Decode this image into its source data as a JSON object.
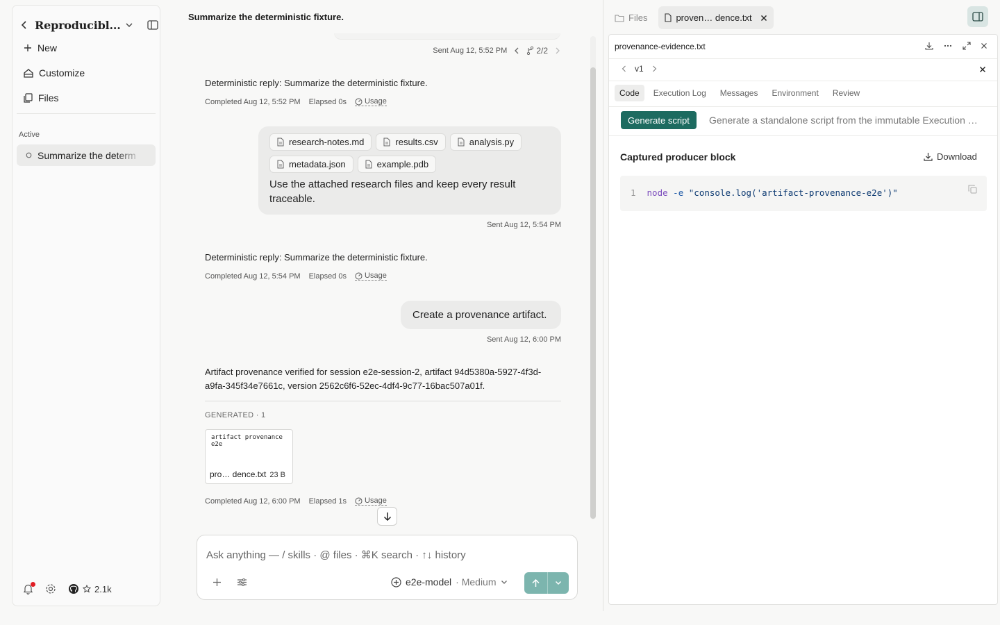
{
  "sidebar": {
    "project_title": "Reproducibl...",
    "nav": [
      {
        "label": "New"
      },
      {
        "label": "Customize"
      },
      {
        "label": "Files"
      }
    ],
    "section_label": "Active",
    "active_session": "Summarize the determ",
    "github_stars": "2.1k"
  },
  "chat": {
    "title": "Summarize the deterministic fixture.",
    "branch_meta": {
      "sent": "Sent Aug 12, 5:52 PM",
      "branch": "2/2"
    },
    "messages": [
      {
        "role": "assistant",
        "text": "Deterministic reply: Summarize the deterministic fixture.",
        "completed": "Completed Aug 12, 5:52 PM",
        "elapsed": "Elapsed 0s",
        "usage": "Usage"
      },
      {
        "role": "user",
        "files": [
          "research-notes.md",
          "results.csv",
          "analysis.py",
          "metadata.json",
          "example.pdb"
        ],
        "text": "Use the attached research files and keep every result traceable.",
        "sent": "Sent Aug 12, 5:54 PM"
      },
      {
        "role": "assistant",
        "text": "Deterministic reply: Summarize the deterministic fixture.",
        "completed": "Completed Aug 12, 5:54 PM",
        "elapsed": "Elapsed 0s",
        "usage": "Usage"
      },
      {
        "role": "user",
        "text": "Create a provenance artifact.",
        "sent": "Sent Aug 12, 6:00 PM"
      },
      {
        "role": "assistant",
        "text": "Artifact provenance verified for session e2e-session-2, artifact 94d5380a-5927-4f3d-a9fa-345f34e7661c, version 2562c6f6-52ec-4df4-9c77-16bac507a01f.",
        "generated_label": "GENERATED · 1",
        "generated_file": {
          "preview": "artifact provenance e2e",
          "name": "pro… dence.txt",
          "size": "23 B"
        },
        "completed": "Completed Aug 12, 6:00 PM",
        "elapsed": "Elapsed 1s",
        "usage": "Usage"
      }
    ]
  },
  "composer": {
    "placeholder": "Ask anything — / skills · @ files · ⌘K search · ↑↓ history",
    "model": "e2e-model",
    "effort": "· Medium"
  },
  "right_panel": {
    "tabs": {
      "files": "Files",
      "active": "proven… dence.txt"
    },
    "file_title": "provenance-evidence.txt",
    "version": "v1",
    "subtabs": [
      "Code",
      "Execution Log",
      "Messages",
      "Environment",
      "Review"
    ],
    "active_subtab": "Code",
    "generate_button": "Generate script",
    "generate_desc": "Generate a standalone script from the immutable Execution …",
    "block_title": "Captured producer block",
    "download_label": "Download",
    "code": {
      "line_no": "1",
      "cmd": "node",
      "flag": "-e",
      "arg": "\"console.log('artifact-provenance-e2e')\""
    }
  },
  "colors": {
    "accent": "#1d6b60",
    "send": "#7cb5ae",
    "notification": "#e11d24"
  }
}
